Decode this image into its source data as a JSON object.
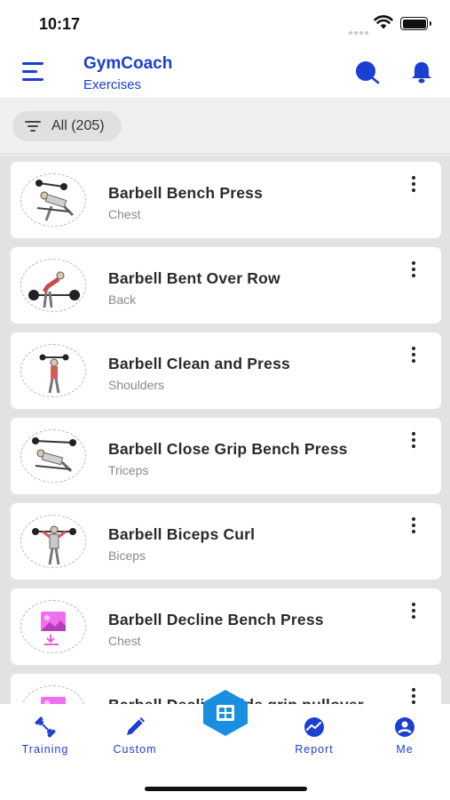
{
  "status_bar": {
    "time": "10:17"
  },
  "header": {
    "title": "GymCoach",
    "subtitle": "Exercises",
    "menu_icon": "menu-icon",
    "search_icon": "search-icon",
    "bell_icon": "bell-icon"
  },
  "filter": {
    "label": "All (205)",
    "icon": "filter-icon"
  },
  "exercises": [
    {
      "name": "Barbell Bench Press",
      "muscle": "Chest"
    },
    {
      "name": "Barbell Bent Over Row",
      "muscle": "Back"
    },
    {
      "name": "Barbell Clean and Press",
      "muscle": "Shoulders"
    },
    {
      "name": "Barbell Close Grip Bench Press",
      "muscle": "Triceps"
    },
    {
      "name": "Barbell Biceps Curl",
      "muscle": "Biceps"
    },
    {
      "name": "Barbell Decline Bench Press",
      "muscle": "Chest"
    },
    {
      "name": "Barbell Decline wide grip pullover",
      "muscle": ""
    }
  ],
  "bottom_nav": {
    "items": [
      {
        "label": "Training",
        "icon": "dumbbell-icon"
      },
      {
        "label": "Custom",
        "icon": "pencil-icon"
      },
      {
        "label": "Report",
        "icon": "report-icon"
      },
      {
        "label": "Me",
        "icon": "user-icon"
      }
    ],
    "center_icon": "grid-icon"
  },
  "colors": {
    "accent": "#1a3fd1",
    "fab": "#1a8fe0",
    "list_background": "#e2e2e2"
  }
}
